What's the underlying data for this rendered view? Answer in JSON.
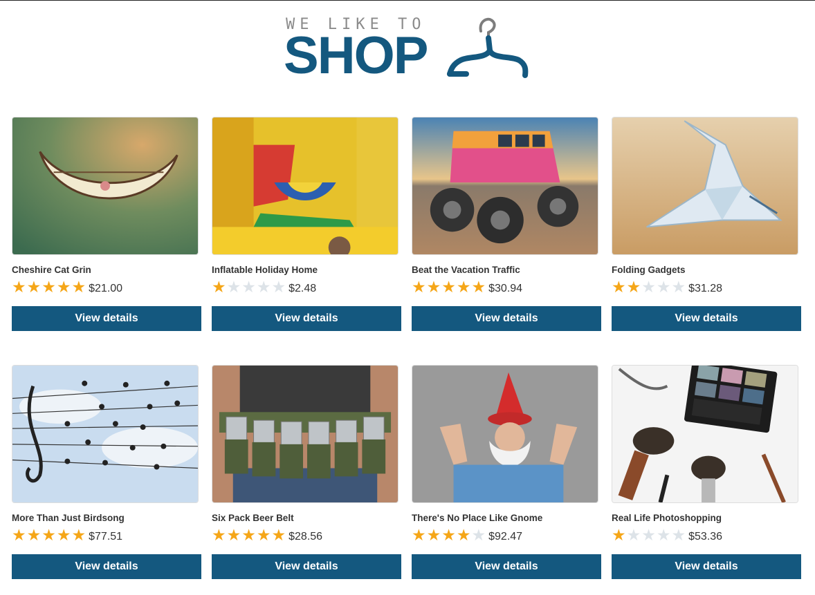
{
  "header": {
    "tagline": "WE LIKE TO",
    "wordmark": "SHOP",
    "icon": "hanger-icon",
    "brand_color": "#14587f"
  },
  "colors": {
    "accent": "#14587f",
    "star_on": "#f5a618",
    "star_off": "#dde3e8"
  },
  "products": [
    {
      "name": "Cheshire Cat Grin",
      "rating": 5,
      "price": "$21.00",
      "button": "View details"
    },
    {
      "name": "Inflatable Holiday Home",
      "rating": 1,
      "price": "$2.48",
      "button": "View details"
    },
    {
      "name": "Beat the Vacation Traffic",
      "rating": 5,
      "price": "$30.94",
      "button": "View details"
    },
    {
      "name": "Folding Gadgets",
      "rating": 2,
      "price": "$31.28",
      "button": "View details"
    },
    {
      "name": "More Than Just Birdsong",
      "rating": 5,
      "price": "$77.51",
      "button": "View details"
    },
    {
      "name": "Six Pack Beer Belt",
      "rating": 5,
      "price": "$28.56",
      "button": "View details"
    },
    {
      "name": "There's No Place Like Gnome",
      "rating": 4,
      "price": "$92.47",
      "button": "View details"
    },
    {
      "name": "Real Life Photoshopping",
      "rating": 1,
      "price": "$53.36",
      "button": "View details"
    }
  ]
}
